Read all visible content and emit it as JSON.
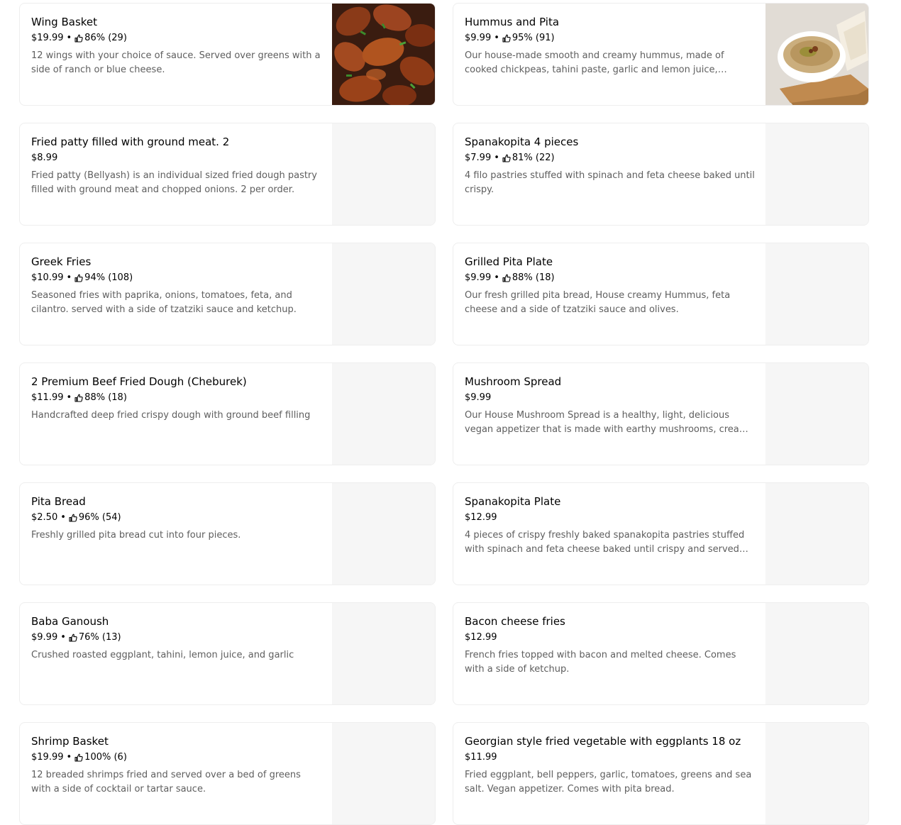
{
  "menu": {
    "items": [
      {
        "title": "Wing Basket",
        "price": "$19.99",
        "rating": "86% (29)",
        "description": "12 wings with your choice of sauce. Served over greens with a side of ranch or blue cheese.",
        "has_image": true,
        "image": "chicken-wings-photo"
      },
      {
        "title": "Hummus and Pita",
        "price": "$9.99",
        "rating": "95% (91)",
        "description": "Our house-made smooth and creamy hummus, made of cooked chickpeas, tahini paste, garlic and lemon juice, topped…",
        "has_image": true,
        "image": "hummus-bowl-photo"
      },
      {
        "title": "Fried patty filled with ground meat. 2",
        "price": "$8.99",
        "rating": "",
        "description": "Fried patty (Bellyash) is an individual sized fried dough pastry filled with ground meat and chopped onions. 2 per order.",
        "has_image": false
      },
      {
        "title": "Spanakopita 4 pieces",
        "price": "$7.99",
        "rating": "81% (22)",
        "description": "4 filo pastries stuffed with spinach and feta cheese baked until crispy.",
        "has_image": false
      },
      {
        "title": "Greek Fries",
        "price": "$10.99",
        "rating": "94% (108)",
        "description": "Seasoned fries with paprika, onions, tomatoes, feta, and cilantro. served with a side of tzatziki sauce and ketchup.",
        "has_image": false
      },
      {
        "title": "Grilled Pita Plate",
        "price": "$9.99",
        "rating": "88% (18)",
        "description": "Our fresh grilled pita bread, House creamy Hummus, feta cheese and a side of tzatziki sauce and olives.",
        "has_image": false
      },
      {
        "title": "2 Premium Beef Fried Dough (Cheburek)",
        "price": "$11.99",
        "rating": "88% (18)",
        "description": "Handcrafted deep fried crispy dough with ground beef filling",
        "has_image": false
      },
      {
        "title": "Mushroom Spread",
        "price": "$9.99",
        "rating": "",
        "description": "Our House Mushroom Spread is a healthy, light, delicious vegan appetizer that is made with earthy mushrooms, cream cheese…",
        "has_image": false
      },
      {
        "title": "Pita Bread",
        "price": "$2.50",
        "rating": "96% (54)",
        "description": "Freshly grilled pita bread cut into four pieces.",
        "has_image": false
      },
      {
        "title": "Spanakopita Plate",
        "price": "$12.99",
        "rating": "",
        "description": "4 pieces of crispy freshly baked spanakopita pastries stuffed with spinach and feta cheese baked until crispy and served…",
        "has_image": false
      },
      {
        "title": "Baba Ganoush",
        "price": "$9.99",
        "rating": "76% (13)",
        "description": "Crushed roasted eggplant, tahini, lemon juice, and garlic",
        "has_image": false
      },
      {
        "title": "Bacon cheese fries",
        "price": "$12.99",
        "rating": "",
        "description": "French fries topped with bacon and melted cheese. Comes with a side of ketchup.",
        "has_image": false
      },
      {
        "title": "Shrimp Basket",
        "price": "$19.99",
        "rating": "100% (6)",
        "description": "12 breaded shrimps fried and served over a bed of greens with a side of cocktail or tartar sauce.",
        "has_image": false
      },
      {
        "title": "Georgian style fried vegetable with eggplants 18 oz",
        "price": "$11.99",
        "rating": "",
        "description": "Fried eggplant, bell peppers, garlic, tomatoes, greens and sea salt. Vegan appetizer. Comes with pita bread.",
        "has_image": false
      }
    ]
  },
  "icons": {
    "rating": "thumbs-up-icon"
  },
  "colors": {
    "title_text": "#000000",
    "description_text": "#5e5e5e",
    "card_border": "#eeeeee",
    "image_placeholder": "#f6f6f6"
  }
}
